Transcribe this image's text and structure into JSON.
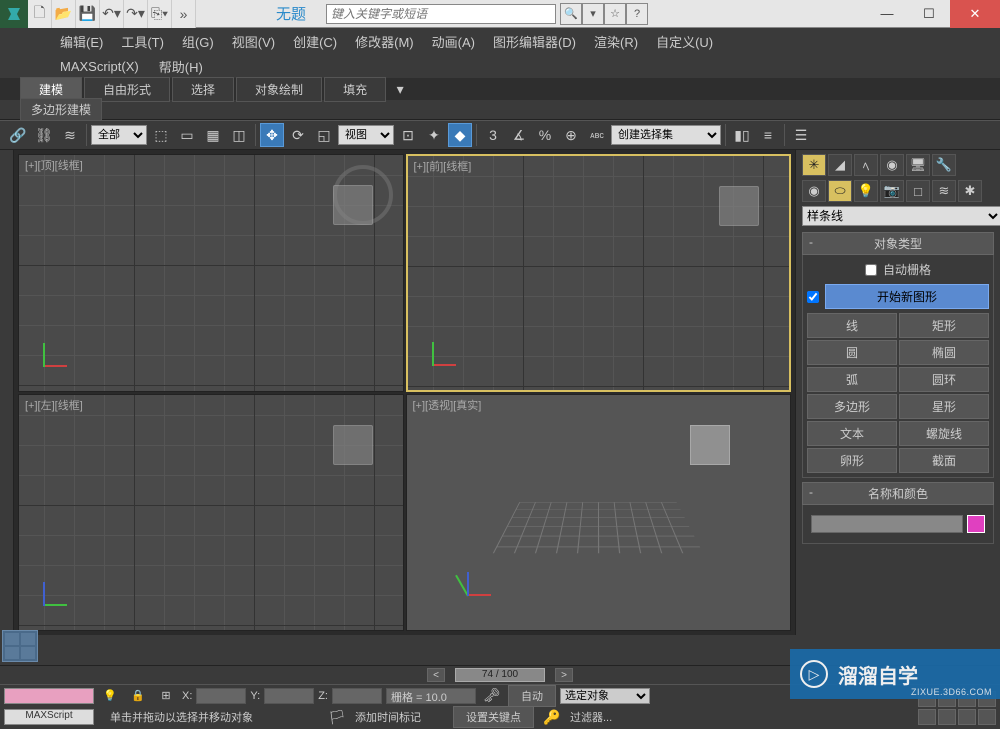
{
  "title": "无题",
  "search_placeholder": "键入关键字或短语",
  "menus": {
    "edit": "编辑(E)",
    "tools": "工具(T)",
    "group": "组(G)",
    "views": "视图(V)",
    "create": "创建(C)",
    "modifiers": "修改器(M)",
    "animation": "动画(A)",
    "grapheditors": "图形编辑器(D)",
    "rendering": "渲染(R)",
    "customize": "自定义(U)",
    "maxscript": "MAXScript(X)",
    "help": "帮助(H)"
  },
  "ribbon": {
    "tabs": [
      "建模",
      "自由形式",
      "选择",
      "对象绘制",
      "填充"
    ],
    "sub": "多边形建模"
  },
  "toolbar": {
    "filter_all": "全部",
    "coord_select": "视图",
    "named_sel": "创建选择集"
  },
  "viewports": {
    "top": "[+][顶][线框]",
    "front": "[+][前][线框]",
    "left": "[+][左][线框]",
    "persp": "[+][透视][真实]"
  },
  "command_panel": {
    "dropdown": "样条线",
    "rollout_type": "对象类型",
    "auto_grid": "自动栅格",
    "start_new_shape": "开始新图形",
    "shapes": [
      "线",
      "矩形",
      "圆",
      "椭圆",
      "弧",
      "圆环",
      "多边形",
      "星形",
      "文本",
      "螺旋线",
      "卵形",
      "截面"
    ],
    "rollout_name": "名称和颜色"
  },
  "timeline": {
    "frame": "74 / 100",
    "grid": "栅格 = 10.0",
    "add_time_tag": "添加时间标记",
    "auto": "自动",
    "set_key": "设置关键点",
    "key_filter_sel": "选定对象",
    "filters": "过滤器..."
  },
  "status": {
    "x": "X:",
    "y": "Y:",
    "z": "Z:",
    "prompt": "单击并拖动以选择并移动对象",
    "maxscript": "MAXScript"
  },
  "watermark": {
    "text": "溜溜自学",
    "url": "ZIXUE.3D66.COM"
  }
}
